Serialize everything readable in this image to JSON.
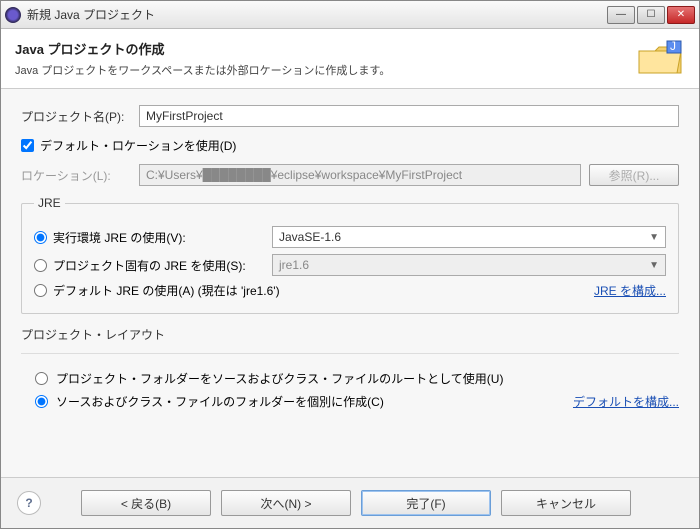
{
  "window": {
    "title": "新規 Java プロジェクト",
    "minimize": "—",
    "maximize": "☐",
    "close": "✕"
  },
  "banner": {
    "heading": "Java プロジェクトの作成",
    "sub": "Java プロジェクトをワークスペースまたは外部ロケーションに作成します。"
  },
  "project": {
    "label": "プロジェクト名(P):",
    "value": "MyFirstProject"
  },
  "defaultLocation": {
    "label": "デフォルト・ロケーションを使用(D)",
    "checked": true
  },
  "location": {
    "label": "ロケーション(L):",
    "value": "C:¥Users¥████████¥eclipse¥workspace¥MyFirstProject",
    "browse": "参照(R)..."
  },
  "jre": {
    "legend": "JRE",
    "option1": "実行環境 JRE の使用(V):",
    "option1_value": "JavaSE-1.6",
    "option2": "プロジェクト固有の JRE を使用(S):",
    "option2_value": "jre1.6",
    "option3": "デフォルト JRE の使用(A) (現在は 'jre1.6')",
    "configure": "JRE を構成..."
  },
  "layout": {
    "legend": "プロジェクト・レイアウト",
    "option1": "プロジェクト・フォルダーをソースおよびクラス・ファイルのルートとして使用(U)",
    "option2": "ソースおよびクラス・ファイルのフォルダーを個別に作成(C)",
    "configure": "デフォルトを構成..."
  },
  "footer": {
    "back": "< 戻る(B)",
    "next": "次へ(N) >",
    "finish": "完了(F)",
    "cancel": "キャンセル",
    "help": "?"
  }
}
